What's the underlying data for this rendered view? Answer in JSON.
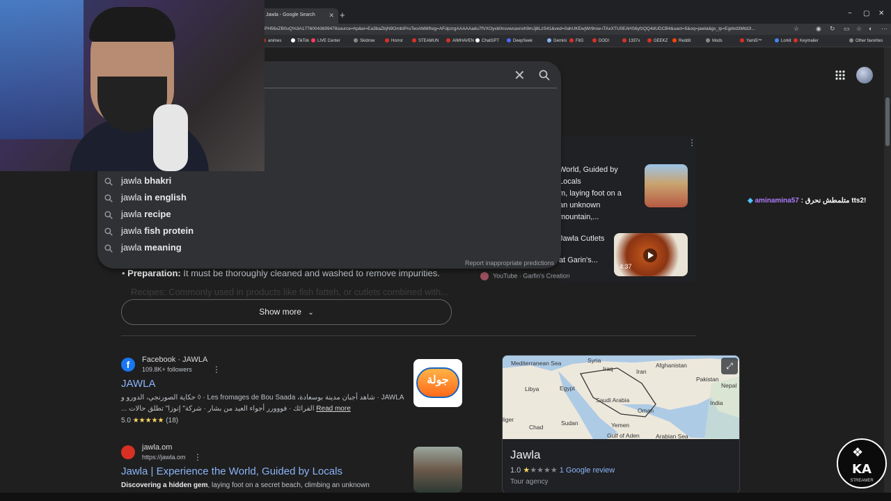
{
  "browser": {
    "tab_title": "Jawla - Google Search",
    "url": "PH56xZB0uQ%3A17760043699478source=hp&ei=Ea3baZbjN9OmbIPruTeoAM8iflsig=AFdpzrgAAAAAadu7fVXOyxb0nsvwcaxnxh9mJj8LzS41&ved=0ahUKEwjWr9rsw-iTAxXTU0EAHS6yfzQQ4dUDCB4&uact=5&oq=jawla&gs_lp=Egdnd3Mtd2l...",
    "new_tab": "+",
    "window_controls": [
      "−",
      "▢",
      "✕"
    ],
    "bookmarks": [
      {
        "label": "animes",
        "color": "#d93025"
      },
      {
        "label": "TikTok",
        "color": "#ffffff"
      },
      {
        "label": "LIVE Center",
        "color": "#ff3b5c"
      },
      {
        "label": "Skidrow",
        "color": "#888888"
      },
      {
        "label": "Horror",
        "color": "#d93025"
      },
      {
        "label": "STEAMUN",
        "color": "#d93025"
      },
      {
        "label": "AIMHAVEN",
        "color": "#d93025"
      },
      {
        "label": "ChatGPT",
        "color": "#ffffff"
      },
      {
        "label": "DeepSeek",
        "color": "#4d6bfe"
      },
      {
        "label": "Gemini",
        "color": "#8ab4f8"
      },
      {
        "label": "FitG",
        "color": "#d93025"
      },
      {
        "label": "DODI",
        "color": "#d93025"
      },
      {
        "label": "1337x",
        "color": "#d93025"
      },
      {
        "label": "GEEKZ",
        "color": "#d93025"
      },
      {
        "label": "Reddit",
        "color": "#ff4500"
      },
      {
        "label": "Mods",
        "color": "#888888"
      },
      {
        "label": "Yami5™",
        "color": "#d93025"
      },
      {
        "label": "Lorkit",
        "color": "#4285f4"
      },
      {
        "label": "Keymailer",
        "color": "#d93025"
      },
      {
        "label": "Other favorites",
        "color": "#888888"
      }
    ]
  },
  "search": {
    "clear_symbol": "✕",
    "suggestions": [
      {
        "prefix": "jawla ",
        "bold": "bhakri"
      },
      {
        "prefix": "jawla ",
        "bold": "in english"
      },
      {
        "prefix": "jawla ",
        "bold": "recipe"
      },
      {
        "prefix": "jawla ",
        "bold": "fish protein"
      },
      {
        "prefix": "jawla ",
        "bold": "meaning"
      }
    ],
    "report_label": "Report inappropriate predictions"
  },
  "videos": [
    {
      "title": "World, Guided by Locals",
      "line2": "m, laying foot on a",
      "line3": "an unknown mountain,..."
    },
    {
      "title": "Jawla Cutlets",
      "line2": "at Garin's...",
      "duration": "4:37",
      "source": "YouTube · Garfin's Creation"
    }
  ],
  "chat": {
    "user": "aminamina57",
    "message": "متلمطش نحرق tts2!"
  },
  "body": {
    "prep_label": "Preparation:",
    "prep_text": " It must be thoroughly cleaned and washed to remove impurities.",
    "prep_faded": "Recipes: Commonly used in products like fish fatteh, or cutlets combined with...",
    "show_more": "Show more"
  },
  "results": [
    {
      "site": "Facebook · JAWLA",
      "sub": "109.8K+ followers",
      "title": "JAWLA",
      "snippet_line1": "حكاية الصورنجي، الدورو و ◊ · Les fromages de Bou Saada ،شاهد أجبان مدينة بوسعادة · JAWLA",
      "snippet_line2": "... الفرائك · فووورر أجواء العيد من بشار · شركة\" إنوزا\" تطلق حالات",
      "read_more": "Read more",
      "rating": "5.0",
      "stars": "★★★★★",
      "count": "(18)",
      "logo_text": "جولة"
    },
    {
      "site": "jawla.om",
      "sub": "https://jawla.om",
      "title": "Jawla | Experience the World, Guided by Locals",
      "snippet_bold": "Discovering a hidden gem",
      "snippet_rest": ", laying foot on a secret beach, climbing an unknown"
    }
  ],
  "knowledge_panel": {
    "map_labels": {
      "med": "Mediterranean Sea",
      "syria": "Syria",
      "iraq": "Iraq",
      "afgh": "Afghanistan",
      "iran": "Iran",
      "pakistan": "Pakistan",
      "nepal": "Nepal",
      "libya": "Libya",
      "egypt": "Egypt",
      "saudi": "Saudi Arabia",
      "india": "India",
      "oman": "Oman",
      "niger": "liger",
      "chad": "Chad",
      "sudan": "Sudan",
      "yemen": "Yemen",
      "aden": "Gulf of Aden",
      "arabian": "Arabian Sea"
    },
    "title": "Jawla",
    "rating": "1.0",
    "review_link": "1 Google review",
    "type": "Tour agency"
  },
  "overlay_logo": {
    "text": "KA",
    "small": "STREAMER"
  }
}
